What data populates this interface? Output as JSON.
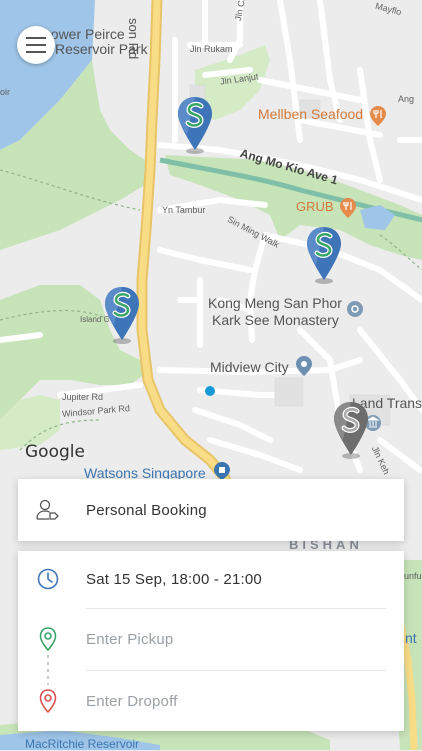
{
  "map": {
    "labels": {
      "lower_peirce": "Lower Peirce",
      "reservoir_park": "Reservoir Park",
      "son_rd": "son Rd",
      "jln_rukam": "Jln Rukam",
      "jln_lanjut": "Jln Lanjut",
      "jln_ch": "Jln Ch",
      "mayflower": "Mayflo",
      "ang": "Ang",
      "oir": "oir",
      "mellben": "Mellben Seafood",
      "ang_mo_kio": "Ang Mo Kio Ave 1",
      "grub": "GRUB",
      "yn_tambur": "Yn Tambur",
      "sin_ming_walk": "Sin Ming Walk",
      "kong_meng": "Kong Meng San Phor",
      "kark_see": "Kark See Monastery",
      "island_c": "Island C",
      "midview": "Midview City",
      "jupiter": "Jupiter Rd",
      "windsor": "Windsor Park Rd",
      "land_trans": "Land Trans",
      "jln_keh": "Jln Keh",
      "watsons": "Watsons Singapore",
      "bishan": "BISHAN",
      "unfu": "unfu",
      "nt": "nt",
      "macritchie": "MacRitchie Reservoir"
    },
    "google_logo": "Google"
  },
  "booking": {
    "label": "Personal Booking"
  },
  "trip": {
    "datetime": "Sat 15 Sep, 18:00 - 21:00",
    "pickup_placeholder": "Enter Pickup",
    "dropoff_placeholder": "Enter Dropoff"
  },
  "colors": {
    "water": "#9fc5e8",
    "park": "#c7e3b8",
    "road_major": "#f5d77a",
    "pin_blue": "#3e74b8",
    "pin_green": "#3aa569",
    "pin_gray": "#6d6d6d",
    "pickup": "#3aa569",
    "dropoff": "#d9534f",
    "clock": "#3e74b8"
  }
}
